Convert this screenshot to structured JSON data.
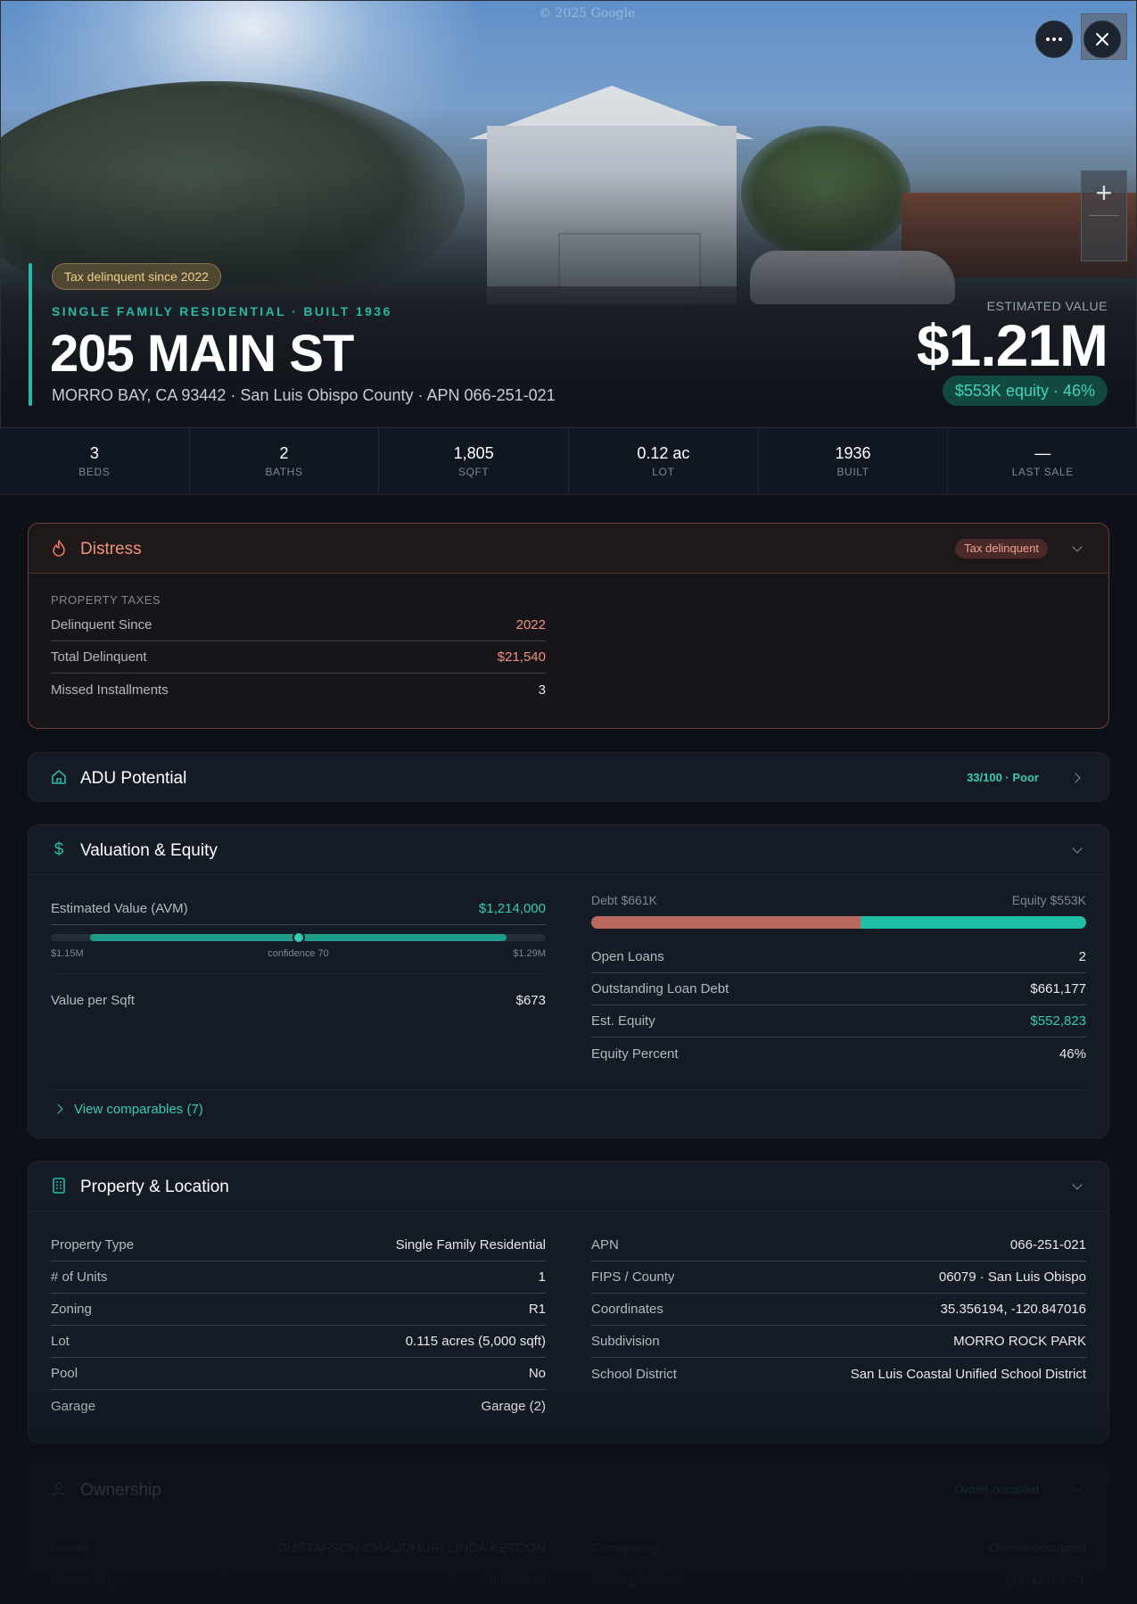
{
  "hero": {
    "watermark": "© 2025 Google",
    "tax_pill": "Tax delinquent since 2022",
    "subtitle": "SINGLE FAMILY RESIDENTIAL · BUILT 1936",
    "title": "205 MAIN ST",
    "address": "MORRO BAY, CA 93442 · San Luis Obispo County · APN 066-251-021",
    "est_label": "ESTIMATED VALUE",
    "est_value": "$1.21M",
    "equity": "$553K equity · 46%",
    "more_icon": "ellipsis-icon",
    "close_icon": "close-icon",
    "zoom_icon": "plus-icon"
  },
  "stats": [
    {
      "value": "3",
      "label": "BEDS"
    },
    {
      "value": "2",
      "label": "BATHS"
    },
    {
      "value": "1,805",
      "label": "SQFT"
    },
    {
      "value": "0.12 ac",
      "label": "LOT"
    },
    {
      "value": "1936",
      "label": "BUILT"
    },
    {
      "value": "—",
      "label": "LAST SALE"
    }
  ],
  "distress": {
    "title": "Distress",
    "badge": "Tax delinquent",
    "section": "PROPERTY TAXES",
    "rows": [
      {
        "k": "Delinquent Since",
        "v": "2022"
      },
      {
        "k": "Total Delinquent",
        "v": "$21,540"
      },
      {
        "k": "Missed Installments",
        "v": "3"
      }
    ]
  },
  "adu": {
    "title": "ADU Potential",
    "score": "33/100 · Poor"
  },
  "valuation": {
    "title": "Valuation & Equity",
    "avm_label": "Estimated Value (AVM)",
    "avm_value": "$1,214,000",
    "range_low": "$1.15M",
    "range_high": "$1.29M",
    "range_low_num": 1.15,
    "range_high_num": 1.29,
    "fill_start": 0.08,
    "fill_end": 0.92,
    "dot_pos": 0.5,
    "confidence": "confidence 70",
    "vps_label": "Value per Sqft",
    "vps_value": "$673",
    "debt_label": "Debt $661K",
    "equity_label": "Equity $553K",
    "debt_fraction": 0.545,
    "rows": [
      {
        "k": "Open Loans",
        "v": "2"
      },
      {
        "k": "Outstanding Loan Debt",
        "v": "$661,177"
      },
      {
        "k": "Est. Equity",
        "v": "$552,823"
      },
      {
        "k": "Equity Percent",
        "v": "46%"
      }
    ],
    "comparables": "View comparables (7)"
  },
  "property": {
    "title": "Property & Location",
    "left": [
      {
        "k": "Property Type",
        "v": "Single Family Residential"
      },
      {
        "k": "# of Units",
        "v": "1"
      },
      {
        "k": "Zoning",
        "v": "R1"
      },
      {
        "k": "Lot",
        "v": "0.115 acres (5,000 sqft)"
      },
      {
        "k": "Pool",
        "v": "No"
      },
      {
        "k": "Garage",
        "v": "Garage (2)"
      }
    ],
    "right": [
      {
        "k": "APN",
        "v": "066-251-021"
      },
      {
        "k": "FIPS / County",
        "v": "06079 · San Luis Obispo"
      },
      {
        "k": "Coordinates",
        "v": "35.356194, -120.847016"
      },
      {
        "k": "Subdivision",
        "v": "MORRO ROCK PARK"
      },
      {
        "k": "School District",
        "v": "San Luis Coastal Unified School District"
      }
    ]
  },
  "ownership": {
    "title": "Ownership",
    "badge": "Owner-occupied",
    "left": [
      {
        "k": "Owner",
        "v": "GUSTAFSON-CHAUDHURI LINDA KETCON"
      },
      {
        "k": "Owner Type",
        "v": "Individual"
      }
    ],
    "right": [
      {
        "k": "Occupancy",
        "v": "Owner-occupied"
      },
      {
        "k": "Mailing Address",
        "v": "205 MAIN ST"
      }
    ]
  },
  "colors": {
    "accent": "#27b9a5",
    "distress": "#f0917e",
    "debt": "#b8695c",
    "equity": "#1fbfa6"
  }
}
